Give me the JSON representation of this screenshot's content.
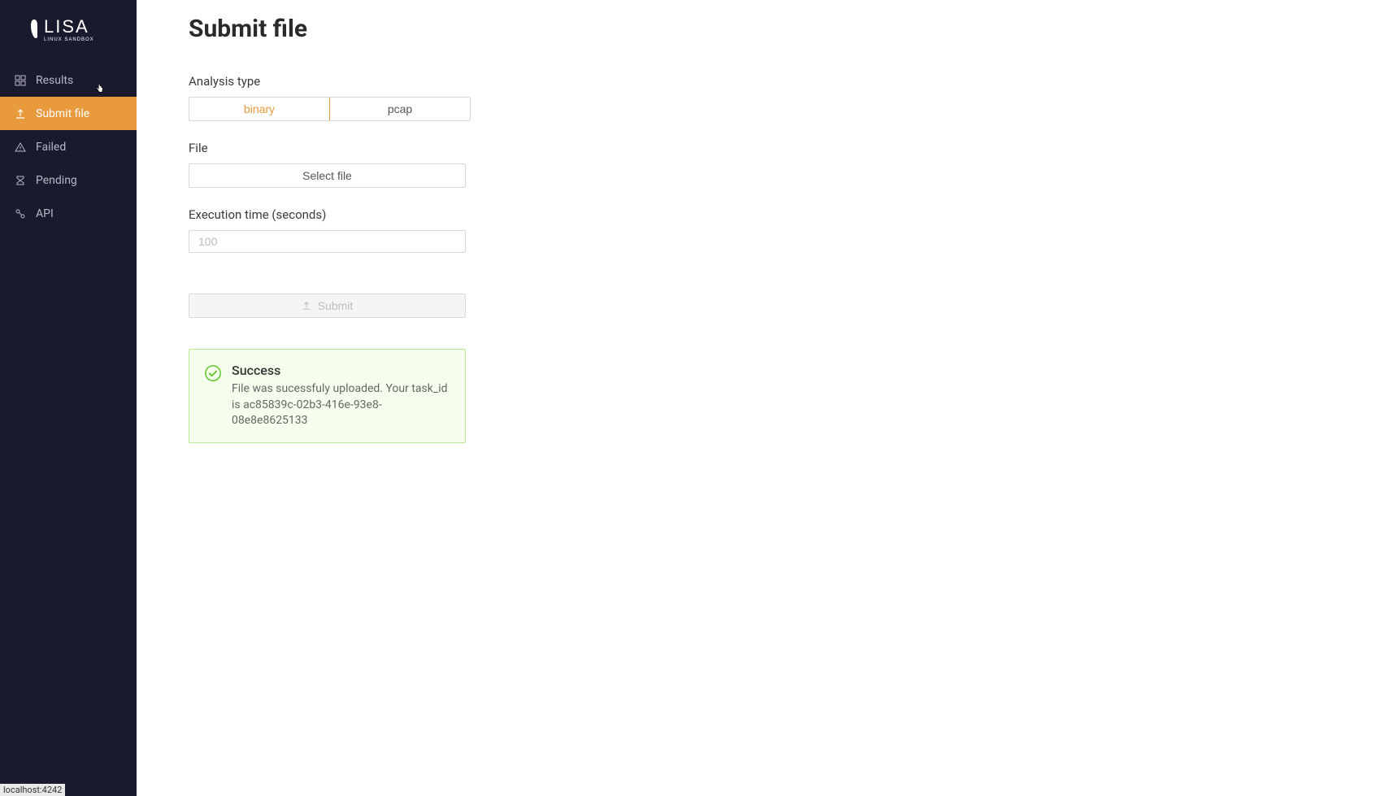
{
  "logo": {
    "name": "LISA",
    "subtitle": "LINUX SANDBOX"
  },
  "sidebar": {
    "items": [
      {
        "label": "Results",
        "icon": "grid-icon",
        "active": false
      },
      {
        "label": "Submit file",
        "icon": "upload-icon",
        "active": true
      },
      {
        "label": "Failed",
        "icon": "warning-icon",
        "active": false
      },
      {
        "label": "Pending",
        "icon": "hourglass-icon",
        "active": false
      },
      {
        "label": "API",
        "icon": "api-icon",
        "active": false
      }
    ]
  },
  "page": {
    "title": "Submit file"
  },
  "form": {
    "analysis_type": {
      "label": "Analysis type",
      "options": [
        "binary",
        "pcap"
      ],
      "selected": "binary"
    },
    "file": {
      "label": "File",
      "button_label": "Select file"
    },
    "exec_time": {
      "label": "Execution time (seconds)",
      "placeholder": "100",
      "value": ""
    },
    "submit_label": "Submit"
  },
  "alert": {
    "title": "Success",
    "description": "File was sucessfuly uploaded. Your task_id is ac85839c-02b3-416e-93e8-08e8e8625133"
  },
  "status_bar": "localhost:4242"
}
